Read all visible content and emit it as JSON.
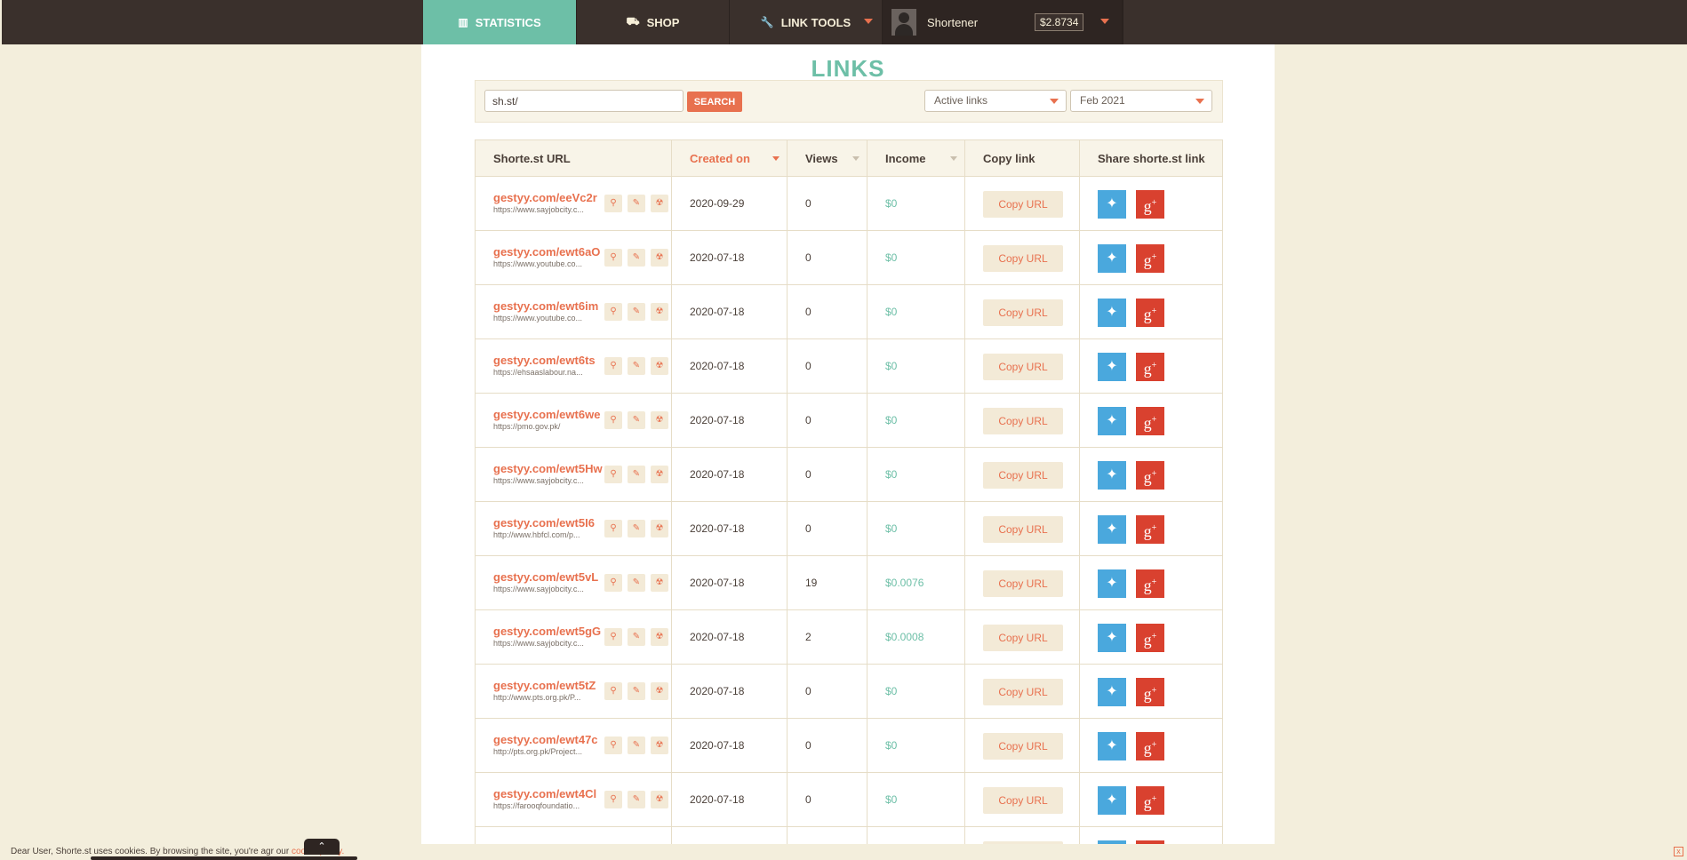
{
  "nav": {
    "statistics": "STATISTICS",
    "shop": "SHOP",
    "link_tools": "LINK TOOLS",
    "user_name": "Shortener",
    "balance": "$2.8734"
  },
  "page_title": "LINKS",
  "filter": {
    "search_value": "sh.st/",
    "search_button": "SEARCH",
    "status_select": "Active links",
    "month_select": "Feb 2021"
  },
  "table": {
    "headers": [
      "Shorte.st URL",
      "Created on",
      "Views",
      "Income",
      "Copy link",
      "Share shorte.st link"
    ],
    "copy_label": "Copy URL",
    "rows": [
      {
        "short": "gestyy.com/eeVc2r",
        "orig": "https://www.sayjobcity.c...",
        "date": "2020-09-29",
        "views": "0",
        "income": "$0"
      },
      {
        "short": "gestyy.com/ewt6aO",
        "orig": "https://www.youtube.co...",
        "date": "2020-07-18",
        "views": "0",
        "income": "$0"
      },
      {
        "short": "gestyy.com/ewt6im",
        "orig": "https://www.youtube.co...",
        "date": "2020-07-18",
        "views": "0",
        "income": "$0"
      },
      {
        "short": "gestyy.com/ewt6ts",
        "orig": "https://ehsaaslabour.na...",
        "date": "2020-07-18",
        "views": "0",
        "income": "$0"
      },
      {
        "short": "gestyy.com/ewt6we",
        "orig": "https://pmo.gov.pk/",
        "date": "2020-07-18",
        "views": "0",
        "income": "$0"
      },
      {
        "short": "gestyy.com/ewt5Hw",
        "orig": "https://www.sayjobcity.c...",
        "date": "2020-07-18",
        "views": "0",
        "income": "$0"
      },
      {
        "short": "gestyy.com/ewt5I6",
        "orig": "http://www.hbfcl.com/p...",
        "date": "2020-07-18",
        "views": "0",
        "income": "$0"
      },
      {
        "short": "gestyy.com/ewt5vL",
        "orig": "https://www.sayjobcity.c...",
        "date": "2020-07-18",
        "views": "19",
        "income": "$0.0076"
      },
      {
        "short": "gestyy.com/ewt5gG",
        "orig": "https://www.sayjobcity.c...",
        "date": "2020-07-18",
        "views": "2",
        "income": "$0.0008"
      },
      {
        "short": "gestyy.com/ewt5tZ",
        "orig": "http://www.pts.org.pk/P...",
        "date": "2020-07-18",
        "views": "0",
        "income": "$0"
      },
      {
        "short": "gestyy.com/ewt47c",
        "orig": "http://pts.org.pk/Project...",
        "date": "2020-07-18",
        "views": "0",
        "income": "$0"
      },
      {
        "short": "gestyy.com/ewt4Cl",
        "orig": "https://farooqfoundatio...",
        "date": "2020-07-18",
        "views": "0",
        "income": "$0"
      },
      {
        "short": "",
        "orig": "",
        "date": "",
        "views": "",
        "income": ""
      }
    ]
  },
  "cookie": {
    "text_before": "Dear User, Shorte.st uses cookies. By browsing the site, you're agr",
    "text_mid": "our",
    "link": "cookie policy.",
    "close": "x"
  },
  "colors": {
    "accent_green": "#6dbfa7",
    "accent_orange": "#e8714f",
    "nav_bg": "#3a302c",
    "page_bg": "#f3eedc",
    "twitter": "#4aa8dd",
    "gplus": "#d9412f"
  },
  "icons": {
    "statistics": "bar-chart-icon",
    "shop": "cart-icon",
    "link_tools": "wrench-icon",
    "row_actions": [
      "search-icon",
      "pencil-icon",
      "trash-icon"
    ],
    "share": [
      "twitter-icon",
      "google-plus-icon"
    ]
  }
}
